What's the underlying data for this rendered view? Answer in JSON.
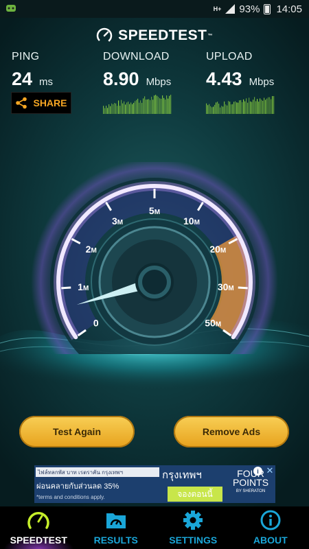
{
  "status_bar": {
    "network": "H+",
    "battery_percent": "93%",
    "time": "14:05",
    "battery_level": 0.93
  },
  "brand": {
    "name": "SPEEDTEST",
    "trademark": "™"
  },
  "metrics": {
    "ping": {
      "label": "PING",
      "value": "24",
      "unit": "ms"
    },
    "download": {
      "label": "DOWNLOAD",
      "value": "8.90",
      "unit": "Mbps"
    },
    "upload": {
      "label": "UPLOAD",
      "value": "4.43",
      "unit": "Mbps"
    }
  },
  "share": {
    "label": "SHARE"
  },
  "gauge": {
    "tick_labels": [
      {
        "num": "0",
        "unit": ""
      },
      {
        "num": "1",
        "unit": "M"
      },
      {
        "num": "2",
        "unit": "M"
      },
      {
        "num": "3",
        "unit": "M"
      },
      {
        "num": "5",
        "unit": "M"
      },
      {
        "num": "10",
        "unit": "M"
      },
      {
        "num": "20",
        "unit": "M"
      },
      {
        "num": "30",
        "unit": "M"
      },
      {
        "num": "50",
        "unit": "M"
      }
    ],
    "needle_value_mbps": 0.6,
    "colors": {
      "arc": "#b58cf2",
      "highlight": "#f29a3a",
      "needle": "#bfe9ef"
    }
  },
  "actions": {
    "test_again": "Test Again",
    "remove_ads": "Remove Ads"
  },
  "ad": {
    "strip": "ไฟล์ทลกพัส บาท เรตราคัน กรุงเทพฯ",
    "city": "กรุงเทพฯ",
    "promo": "ผ่อนคลายกับส่วนลด 35%",
    "terms": "*terms and conditions apply.",
    "book": "จองตอนนี้",
    "brand_line1": "FOUR",
    "brand_line2": "POINTS",
    "brand_sub": "BY SHERATON",
    "info": "i",
    "close": "✕"
  },
  "nav": [
    {
      "label": "SPEEDTEST",
      "icon": "speedometer-icon",
      "active": true
    },
    {
      "label": "RESULTS",
      "icon": "folder-icon",
      "active": false
    },
    {
      "label": "SETTINGS",
      "icon": "gear-icon",
      "active": false
    },
    {
      "label": "ABOUT",
      "icon": "info-icon",
      "active": false
    }
  ]
}
